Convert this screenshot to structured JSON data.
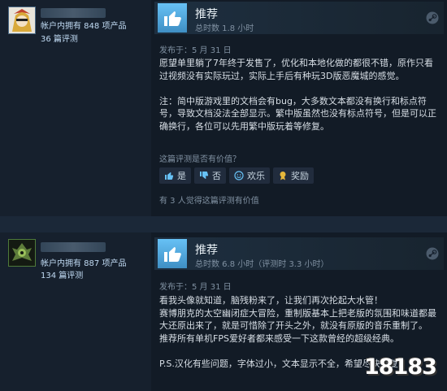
{
  "reviews": [
    {
      "author": {
        "products_owned": "帐户内拥有 848 项产品",
        "reviews_count": "36 篇评测"
      },
      "verdict": "推荐",
      "hours": "总时数 1.8 小时",
      "posted": "发布于：5 月 31 日",
      "body": "愿望单里躺了7年终于发售了，优化和本地化做的都很不错，原作只看过视频没有实际玩过，实际上手后有种玩3D版恶魔城的感觉。\n\n注：简中版游戏里的文档会有bug，大多数文本都没有换行和标点符号，导致文档没法全部显示。繁中版虽然也没有标点符号，但是可以正确换行，各位可以先用繁中版玩着等修复。",
      "helpful_question": "这篇评测是否有价值？",
      "buttons": {
        "yes": "是",
        "no": "否",
        "funny": "欢乐",
        "award": "奖励"
      },
      "found_helpful": "有 3 人觉得这篇评测有价值"
    },
    {
      "author": {
        "products_owned": "帐户内拥有 887 项产品",
        "reviews_count": "134 篇评测"
      },
      "verdict": "推荐",
      "hours": "总时数 6.8 小时（评测时 3.3 小时）",
      "posted": "发布于：5 月 31 日",
      "body": "看我头像就知道，脑残粉来了，让我们再次抡起大水管！\n赛博朋克的太空幽闭症大冒险，重制版基本上把老版的氛围和味道都最大还原出来了，就是可惜除了开头之外，就没有原版的音乐重制了。\n推荐所有单机FPS爱好者都来感受一下这款曾经的超级经典。\n\nP.S.汉化有些问题，字体过小，文本显示不全，希望尽快修复。"
    }
  ],
  "watermark": "18183",
  "colors": {
    "background": "#1b2838",
    "panel": "#16202d",
    "thumb": "#67c1f5",
    "muted_text": "#8091a2"
  },
  "icons": [
    "thumbs-up-icon",
    "steam-icon",
    "thumb-up-small-icon",
    "thumb-down-small-icon",
    "smile-icon",
    "award-icon"
  ]
}
